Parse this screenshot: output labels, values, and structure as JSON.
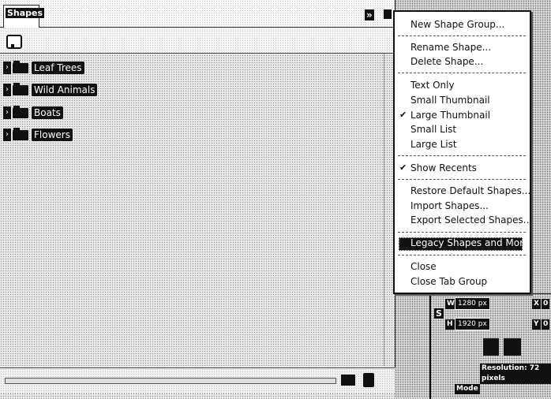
{
  "panel": {
    "tab_label": "Shapes",
    "collapse_glyph": "»",
    "items": [
      {
        "label": "Leaf Trees"
      },
      {
        "label": "Wild Animals"
      },
      {
        "label": "Boats"
      },
      {
        "label": "Flowers"
      }
    ]
  },
  "menu": {
    "new_group": "New Shape Group...",
    "rename": "Rename Shape...",
    "delete": "Delete Shape...",
    "text_only": "Text Only",
    "small_thumb": "Small Thumbnail",
    "large_thumb": "Large Thumbnail",
    "small_list": "Small List",
    "large_list": "Large List",
    "show_recents": "Show Recents",
    "restore": "Restore Default Shapes...",
    "import": "Import Shapes...",
    "export": "Export Selected Shapes...",
    "legacy": "Legacy Shapes and More",
    "close": "Close",
    "close_group": "Close Tab Group",
    "checked_items": [
      "Large Thumbnail",
      "Show Recents"
    ]
  },
  "right_panel": {
    "w_label": "W",
    "h_label": "H",
    "x_label": "X",
    "y_label": "Y",
    "w_value": "1280 px",
    "h_value": "1920 px",
    "x_short": "0",
    "y_short": "0",
    "resolution": "Resolution: 72 pixels",
    "mode": "Mode",
    "side_letter": "S"
  },
  "icons": [
    "chevron-right-icon",
    "folder-icon",
    "new-shape-icon",
    "new-folder-icon",
    "trash-icon",
    "link-icon",
    "checkmark-icon"
  ]
}
